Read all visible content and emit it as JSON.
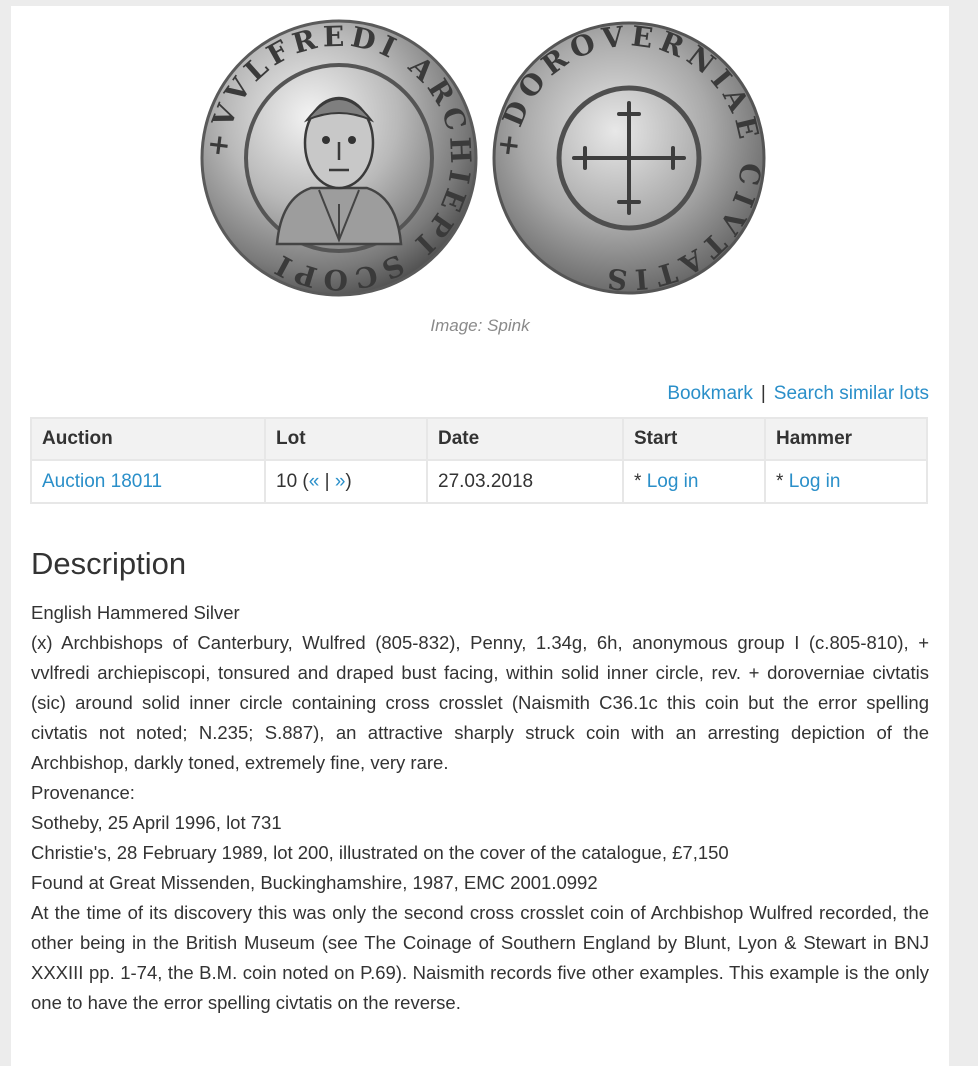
{
  "image": {
    "credit": "Image: Spink",
    "obverse_legend": "+VVLFREDI ARCHIEPI SCOPI",
    "reverse_legend": "+DOROVERNIAE CIVTATIS"
  },
  "actions": {
    "bookmark": "Bookmark",
    "separator": "|",
    "search_similar": "Search similar lots"
  },
  "table": {
    "headers": [
      "Auction",
      "Lot",
      "Date",
      "Start",
      "Hammer"
    ],
    "row": {
      "auction": "Auction 18011",
      "lot_number": "10 (",
      "prev": "«",
      "lot_sep": " | ",
      "next": "»",
      "lot_close": ")",
      "date": "27.03.2018",
      "start_prefix": "* ",
      "start_link": "Log in",
      "hammer_prefix": "* ",
      "hammer_link": "Log in"
    }
  },
  "description": {
    "heading": "Description",
    "lines": [
      "English Hammered Silver",
      "(x) Archbishops of Canterbury, Wulfred (805-832), Penny, 1.34g, 6h, anonymous group I (c.805-810), + vvlfredi archiepiscopi, tonsured and draped bust facing, within solid inner circle, rev. + doroverniae civtatis (sic) around solid inner circle containing cross crosslet (Naismith C36.1c this coin but the error spelling civtatis not noted; N.235; S.887), an attractive sharply struck coin with an arresting depiction of the Archbishop, darkly toned, extremely fine, very rare.",
      "Provenance:",
      "Sotheby, 25 April 1996, lot 731",
      "Christie's, 28 February 1989, lot 200, illustrated on the cover of the catalogue, £7,150",
      "Found at Great Missenden, Buckinghamshire, 1987, EMC 2001.0992",
      "At the time of its discovery this was only the second cross crosslet coin of Archbishop Wulfred recorded, the other being in the British Museum (see The Coinage of Southern England by Blunt, Lyon & Stewart in BNJ XXXIII pp. 1-74, the B.M. coin noted on P.69). Naismith records five other examples. This example is the only one to have the error spelling civtatis on the reverse."
    ]
  }
}
